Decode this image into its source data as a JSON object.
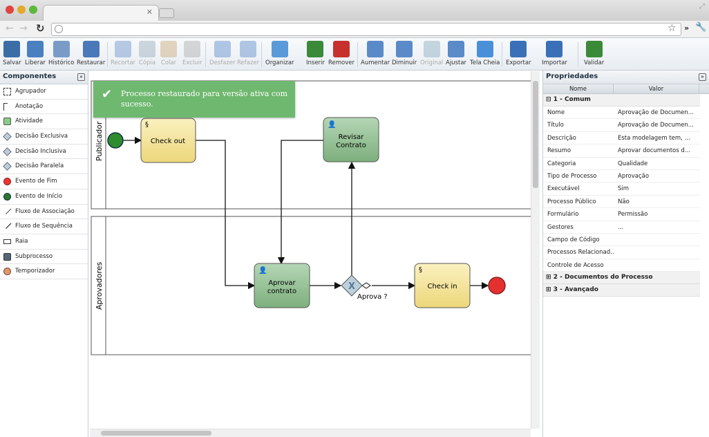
{
  "toolbar": {
    "items": [
      "Salvar",
      "Liberar",
      "Histórico",
      "Restaurar",
      "Recortar",
      "Cópia",
      "Colar",
      "Excluir",
      "Desfazer",
      "Refazer",
      "Organizar",
      "Inserir",
      "Remover",
      "Aumentar",
      "Diminuir",
      "Original",
      "Ajustar",
      "Tela Cheia",
      "Exportar",
      "Importar",
      "Validar"
    ]
  },
  "left": {
    "title": "Componentes",
    "items": [
      "Agrupador",
      "Anotação",
      "Atividade",
      "Decisão Exclusiva",
      "Decisão Inclusiva",
      "Decisão Paralela",
      "Evento de Fim",
      "Evento de Início",
      "Fluxo de Associação",
      "Fluxo de Sequência",
      "Raia",
      "Subprocesso",
      "Temporizador"
    ]
  },
  "toast": {
    "message": "Processo restaurado para versão ativa com sucesso."
  },
  "diagram": {
    "lanes": [
      "Publicador",
      "Aprovadores"
    ],
    "tasks": {
      "checkout": "Check out",
      "revisar": "Revisar Contrato",
      "aprovar": "Aprovar contrato",
      "checkin": "Check in"
    },
    "gateway_label": "Aprova ?"
  },
  "right": {
    "title": "Propriedades",
    "col_name": "Nome",
    "col_value": "Valor",
    "groups": [
      "1 - Comum",
      "2 - Documentos do Processo",
      "3 - Avançado"
    ],
    "props": [
      [
        "Nome",
        "Aprovação de Documen..."
      ],
      [
        "Título",
        "Aprovação de Documen..."
      ],
      [
        "Descrição",
        "Esta modelagem tem, ..."
      ],
      [
        "Resumo",
        "Aprovar documentos d..."
      ],
      [
        "Categoria",
        "Qualidade"
      ],
      [
        "Tipo de Processo",
        "Aprovação"
      ],
      [
        "Executável",
        "Sim"
      ],
      [
        "Processo Público",
        "Não"
      ],
      [
        "Formulário",
        "Permissão"
      ],
      [
        "Gestores",
        "..."
      ],
      [
        "Campo de Código",
        ""
      ],
      [
        "Processos Relacionad...",
        ""
      ],
      [
        "Controle de Acesso",
        ""
      ]
    ]
  },
  "colors": {
    "toast": "#6fb86f",
    "task_yellow": "#f0dc8a",
    "task_green": "#8dbb8d",
    "start": "#2e8b2e",
    "end": "#e53030"
  }
}
